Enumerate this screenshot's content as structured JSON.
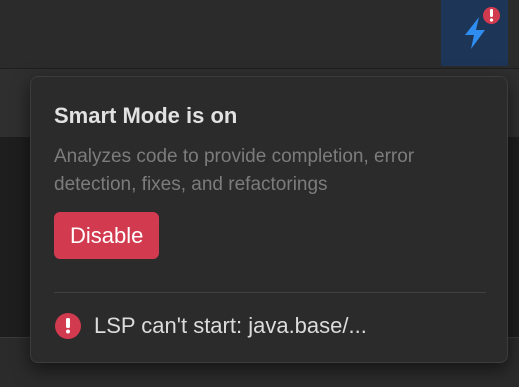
{
  "toolbar": {
    "mode_button_icon": "lightning-bolt-icon",
    "mode_badge_icon": "exclamation-icon",
    "accent_color": "#2f8df0",
    "badge_color": "#d23a4f"
  },
  "popup": {
    "title": "Smart Mode is on",
    "description": "Analyzes code to provide completion, error detection, fixes, and refactorings",
    "disable_label": "Disable",
    "error": {
      "icon": "error-icon",
      "text": "LSP can't start: java.base/..."
    }
  }
}
